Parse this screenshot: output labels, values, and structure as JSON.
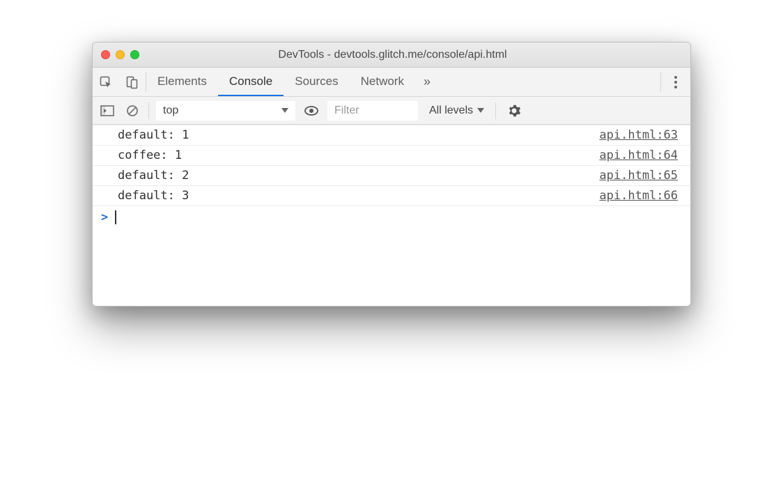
{
  "window": {
    "title": "DevTools - devtools.glitch.me/console/api.html"
  },
  "tabs": {
    "items": [
      "Elements",
      "Console",
      "Sources",
      "Network"
    ],
    "active": "Console",
    "overflow_glyph": "»"
  },
  "console_toolbar": {
    "context": "top",
    "filter_placeholder": "Filter",
    "levels_label": "All levels"
  },
  "logs": [
    {
      "message": "default: 1",
      "source": "api.html:63"
    },
    {
      "message": "coffee: 1",
      "source": "api.html:64"
    },
    {
      "message": "default: 2",
      "source": "api.html:65"
    },
    {
      "message": "default: 3",
      "source": "api.html:66"
    }
  ],
  "prompt": {
    "caret": ">"
  }
}
